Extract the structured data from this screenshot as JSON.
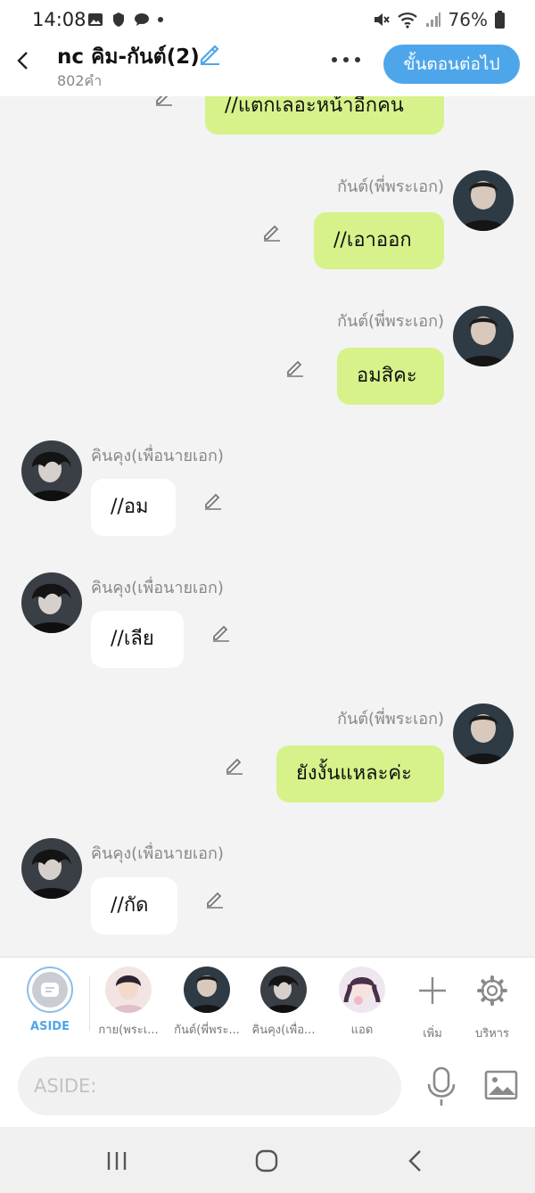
{
  "status_bar": {
    "time": "14:08",
    "battery": "76%"
  },
  "header": {
    "title": "nc คิม-กันต์(2)",
    "subtitle": "802คำ",
    "next_button": "ขั้นตอนต่อไป"
  },
  "messages": [
    {
      "side": "right",
      "text": "//แตกเลอะหน้าอีกคน",
      "partial": true
    },
    {
      "side": "right",
      "name": "กันต์(พี่พระเอก)",
      "text": "//เอาออก"
    },
    {
      "side": "right",
      "name": "กันต์(พี่พระเอก)",
      "text": "อมสิคะ"
    },
    {
      "side": "left",
      "name": "คินคุง(เพื่อนายเอก)",
      "text": "//อม"
    },
    {
      "side": "left",
      "name": "คินคุง(เพื่อนายเอก)",
      "text": "//เลีย"
    },
    {
      "side": "right",
      "name": "กันต์(พี่พระเอก)",
      "text": "ยังงั้นแหละค่ะ"
    },
    {
      "side": "left",
      "name": "คินคุง(เพื่อนายเอก)",
      "text": "//กัด"
    }
  ],
  "characters": [
    {
      "label": "ASIDE"
    },
    {
      "label": "กาย(พระเ..."
    },
    {
      "label": "กันต์(พี่พระ..."
    },
    {
      "label": "คินคุง(เพื่อ..."
    },
    {
      "label": "แอด"
    },
    {
      "label": "เพิ่ม"
    },
    {
      "label": "บริหาร"
    }
  ],
  "input": {
    "placeholder": "ASIDE:"
  },
  "colors": {
    "accent": "#4ea6ea",
    "bubble_green": "#d7f28a",
    "bubble_white": "#ffffff",
    "background": "#f3f3f3"
  }
}
